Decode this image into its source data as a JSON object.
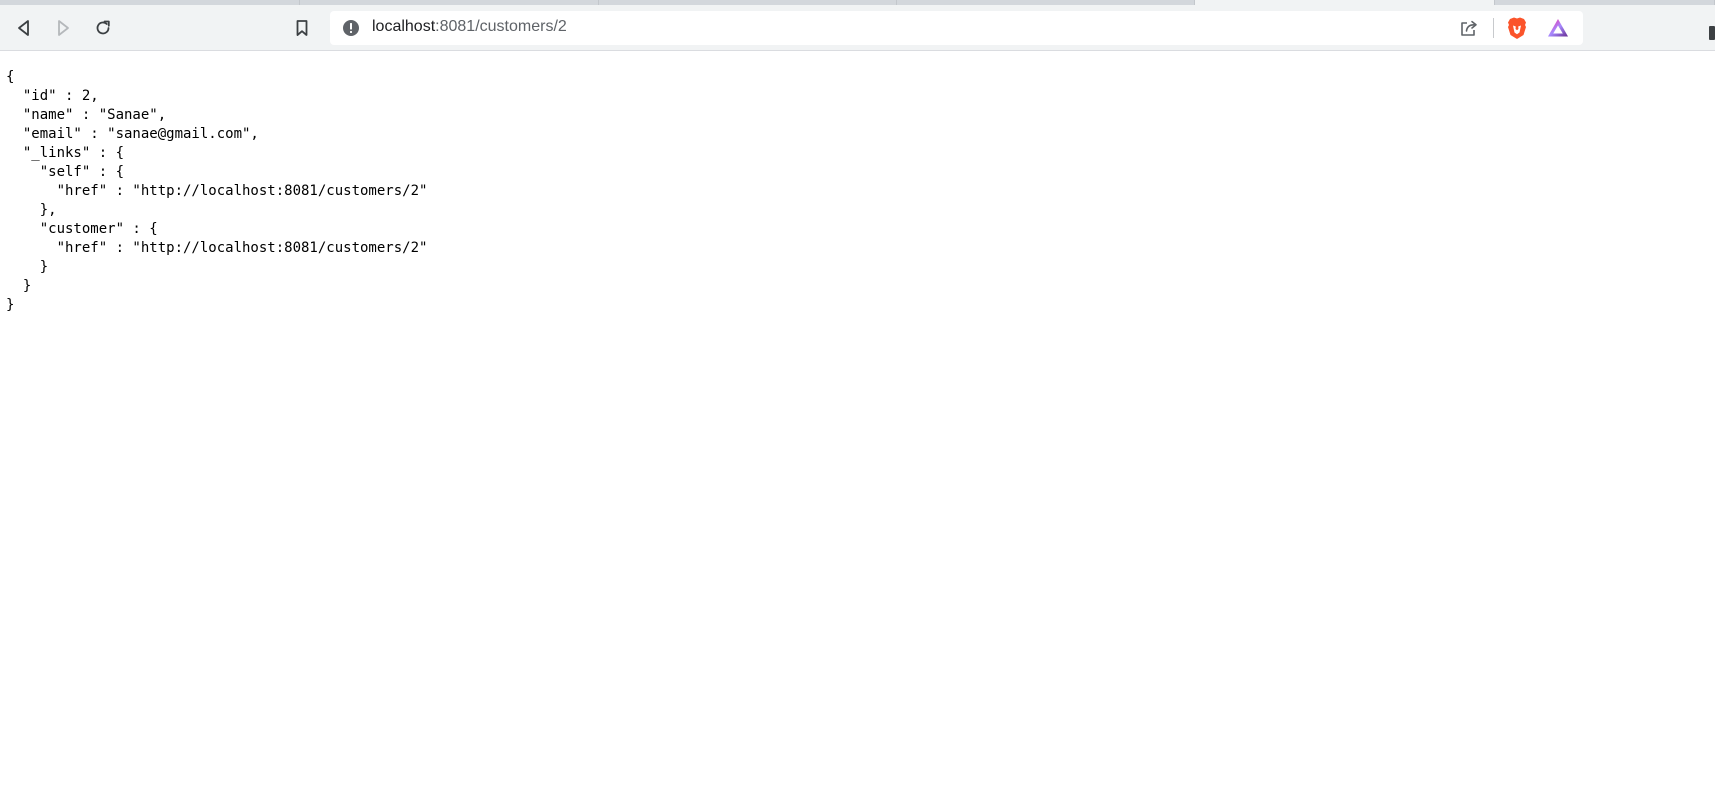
{
  "browser": {
    "address_bar": {
      "host": "localhost",
      "path": ":8081/customers/2"
    },
    "icons": {
      "back": "back-icon",
      "forward": "forward-icon",
      "reload": "reload-icon",
      "bookmark": "bookmark-icon",
      "site_info": "info-icon",
      "share": "share-icon",
      "brave_shields": "brave-lion-icon",
      "brave_rewards": "rewards-triangle-icon"
    },
    "colors": {
      "toolbar_bg": "#f1f3f4",
      "brave_orange": "#fb542b",
      "rewards_purple": "#662d91"
    }
  },
  "page": {
    "json_text": "{\n  \"id\" : 2,\n  \"name\" : \"Sanae\",\n  \"email\" : \"sanae@gmail.com\",\n  \"_links\" : {\n    \"self\" : {\n      \"href\" : \"http://localhost:8081/customers/2\"\n    },\n    \"customer\" : {\n      \"href\" : \"http://localhost:8081/customers/2\"\n    }\n  }\n}"
  }
}
